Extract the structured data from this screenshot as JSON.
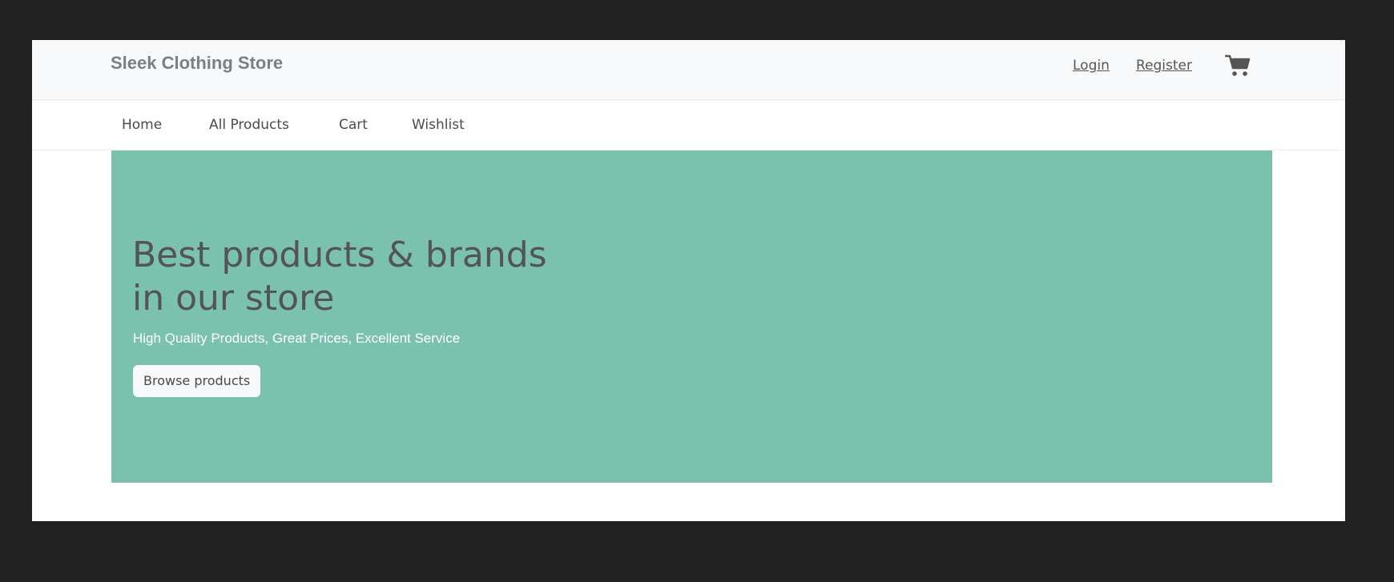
{
  "header": {
    "brand": "Sleek Clothing Store",
    "login_label": "Login",
    "register_label": "Register",
    "cart_icon": "shopping-cart-icon"
  },
  "nav": {
    "items": [
      {
        "label": "Home"
      },
      {
        "label": "All Products"
      },
      {
        "label": "Cart"
      },
      {
        "label": "Wishlist"
      }
    ]
  },
  "hero": {
    "title": "Best products & brands in our store",
    "subtitle": "High Quality Products, Great Prices, Excellent Service",
    "button_label": "Browse products",
    "background_color": "#7ac2ad"
  },
  "colors": {
    "window_background": "#212121",
    "header_background": "#f8f9fa",
    "text": "#555555"
  }
}
